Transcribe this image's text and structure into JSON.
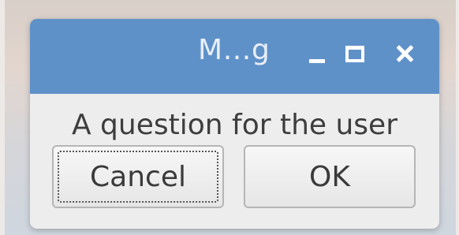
{
  "window": {
    "title": "M…g",
    "controls": {
      "minimize_icon": "minimize-icon",
      "maximize_icon": "maximize-icon",
      "close_icon": "close-icon"
    },
    "accent_color": "#5f91c9"
  },
  "dialog": {
    "message": "A question for the user",
    "buttons": {
      "cancel_label": "Cancel",
      "ok_label": "OK"
    }
  }
}
